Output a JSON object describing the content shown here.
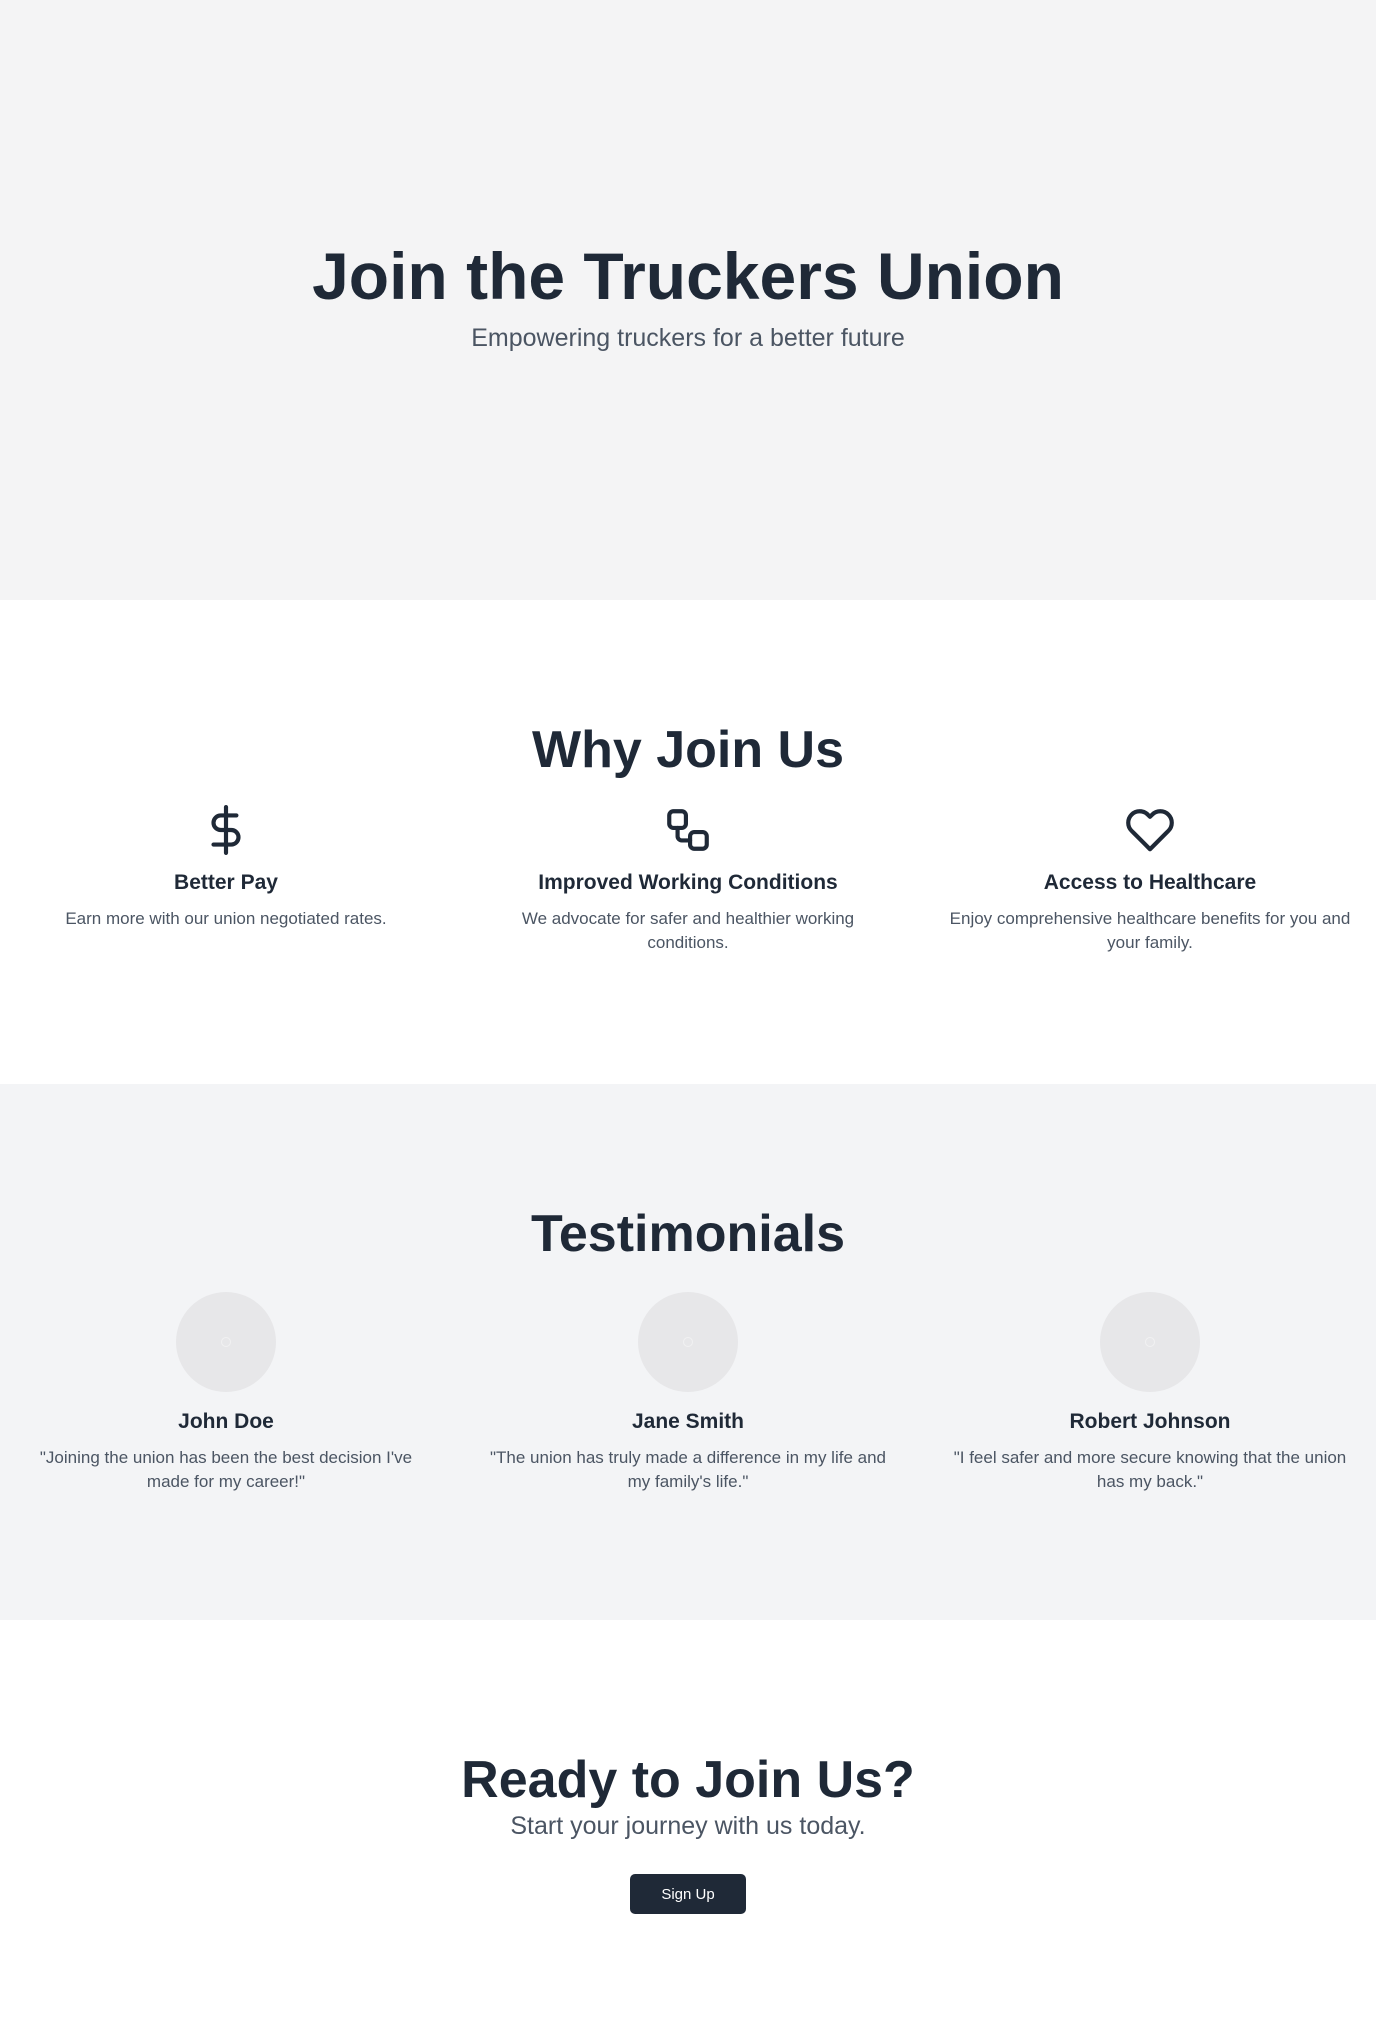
{
  "hero": {
    "title": "Join the Truckers Union",
    "subtitle": "Empowering truckers for a better future"
  },
  "features": {
    "title": "Why Join Us",
    "items": [
      {
        "icon": "dollar-sign-icon",
        "title": "Better Pay",
        "description": "Earn more with our union negotiated rates."
      },
      {
        "icon": "linked-squares-icon",
        "title": "Improved Working Conditions",
        "description": "We advocate for safer and healthier working conditions."
      },
      {
        "icon": "heart-icon",
        "title": "Access to Healthcare",
        "description": "Enjoy comprehensive healthcare benefits for you and your family."
      }
    ]
  },
  "testimonials": {
    "title": "Testimonials",
    "items": [
      {
        "name": "John Doe",
        "quote": "\"Joining the union has been the best decision I've made for my career!\""
      },
      {
        "name": "Jane Smith",
        "quote": "\"The union has truly made a difference in my life and my family's life.\""
      },
      {
        "name": "Robert Johnson",
        "quote": "\"I feel safer and more secure knowing that the union has my back.\""
      }
    ]
  },
  "cta": {
    "title": "Ready to Join Us?",
    "subtitle": "Start your journey with us today.",
    "button_label": "Sign Up"
  },
  "colors": {
    "text_primary": "#1f2937",
    "text_secondary": "#4b5563",
    "hero_bg": "#f4f4f5",
    "testimonials_bg": "#f3f4f6",
    "button_bg": "#1f2937"
  }
}
